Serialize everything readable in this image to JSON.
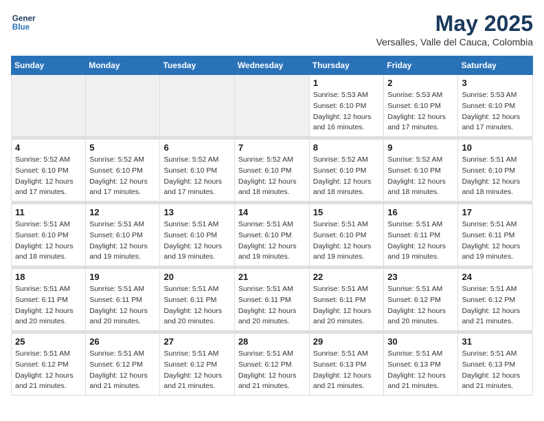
{
  "logo": {
    "line1": "General",
    "line2": "Blue"
  },
  "title": "May 2025",
  "subtitle": "Versalles, Valle del Cauca, Colombia",
  "weekdays": [
    "Sunday",
    "Monday",
    "Tuesday",
    "Wednesday",
    "Thursday",
    "Friday",
    "Saturday"
  ],
  "weeks": [
    [
      {
        "day": "",
        "info": ""
      },
      {
        "day": "",
        "info": ""
      },
      {
        "day": "",
        "info": ""
      },
      {
        "day": "",
        "info": ""
      },
      {
        "day": "1",
        "info": "Sunrise: 5:53 AM\nSunset: 6:10 PM\nDaylight: 12 hours\nand 16 minutes."
      },
      {
        "day": "2",
        "info": "Sunrise: 5:53 AM\nSunset: 6:10 PM\nDaylight: 12 hours\nand 17 minutes."
      },
      {
        "day": "3",
        "info": "Sunrise: 5:53 AM\nSunset: 6:10 PM\nDaylight: 12 hours\nand 17 minutes."
      }
    ],
    [
      {
        "day": "4",
        "info": "Sunrise: 5:52 AM\nSunset: 6:10 PM\nDaylight: 12 hours\nand 17 minutes."
      },
      {
        "day": "5",
        "info": "Sunrise: 5:52 AM\nSunset: 6:10 PM\nDaylight: 12 hours\nand 17 minutes."
      },
      {
        "day": "6",
        "info": "Sunrise: 5:52 AM\nSunset: 6:10 PM\nDaylight: 12 hours\nand 17 minutes."
      },
      {
        "day": "7",
        "info": "Sunrise: 5:52 AM\nSunset: 6:10 PM\nDaylight: 12 hours\nand 18 minutes."
      },
      {
        "day": "8",
        "info": "Sunrise: 5:52 AM\nSunset: 6:10 PM\nDaylight: 12 hours\nand 18 minutes."
      },
      {
        "day": "9",
        "info": "Sunrise: 5:52 AM\nSunset: 6:10 PM\nDaylight: 12 hours\nand 18 minutes."
      },
      {
        "day": "10",
        "info": "Sunrise: 5:51 AM\nSunset: 6:10 PM\nDaylight: 12 hours\nand 18 minutes."
      }
    ],
    [
      {
        "day": "11",
        "info": "Sunrise: 5:51 AM\nSunset: 6:10 PM\nDaylight: 12 hours\nand 18 minutes."
      },
      {
        "day": "12",
        "info": "Sunrise: 5:51 AM\nSunset: 6:10 PM\nDaylight: 12 hours\nand 19 minutes."
      },
      {
        "day": "13",
        "info": "Sunrise: 5:51 AM\nSunset: 6:10 PM\nDaylight: 12 hours\nand 19 minutes."
      },
      {
        "day": "14",
        "info": "Sunrise: 5:51 AM\nSunset: 6:10 PM\nDaylight: 12 hours\nand 19 minutes."
      },
      {
        "day": "15",
        "info": "Sunrise: 5:51 AM\nSunset: 6:10 PM\nDaylight: 12 hours\nand 19 minutes."
      },
      {
        "day": "16",
        "info": "Sunrise: 5:51 AM\nSunset: 6:11 PM\nDaylight: 12 hours\nand 19 minutes."
      },
      {
        "day": "17",
        "info": "Sunrise: 5:51 AM\nSunset: 6:11 PM\nDaylight: 12 hours\nand 19 minutes."
      }
    ],
    [
      {
        "day": "18",
        "info": "Sunrise: 5:51 AM\nSunset: 6:11 PM\nDaylight: 12 hours\nand 20 minutes."
      },
      {
        "day": "19",
        "info": "Sunrise: 5:51 AM\nSunset: 6:11 PM\nDaylight: 12 hours\nand 20 minutes."
      },
      {
        "day": "20",
        "info": "Sunrise: 5:51 AM\nSunset: 6:11 PM\nDaylight: 12 hours\nand 20 minutes."
      },
      {
        "day": "21",
        "info": "Sunrise: 5:51 AM\nSunset: 6:11 PM\nDaylight: 12 hours\nand 20 minutes."
      },
      {
        "day": "22",
        "info": "Sunrise: 5:51 AM\nSunset: 6:11 PM\nDaylight: 12 hours\nand 20 minutes."
      },
      {
        "day": "23",
        "info": "Sunrise: 5:51 AM\nSunset: 6:12 PM\nDaylight: 12 hours\nand 20 minutes."
      },
      {
        "day": "24",
        "info": "Sunrise: 5:51 AM\nSunset: 6:12 PM\nDaylight: 12 hours\nand 21 minutes."
      }
    ],
    [
      {
        "day": "25",
        "info": "Sunrise: 5:51 AM\nSunset: 6:12 PM\nDaylight: 12 hours\nand 21 minutes."
      },
      {
        "day": "26",
        "info": "Sunrise: 5:51 AM\nSunset: 6:12 PM\nDaylight: 12 hours\nand 21 minutes."
      },
      {
        "day": "27",
        "info": "Sunrise: 5:51 AM\nSunset: 6:12 PM\nDaylight: 12 hours\nand 21 minutes."
      },
      {
        "day": "28",
        "info": "Sunrise: 5:51 AM\nSunset: 6:12 PM\nDaylight: 12 hours\nand 21 minutes."
      },
      {
        "day": "29",
        "info": "Sunrise: 5:51 AM\nSunset: 6:13 PM\nDaylight: 12 hours\nand 21 minutes."
      },
      {
        "day": "30",
        "info": "Sunrise: 5:51 AM\nSunset: 6:13 PM\nDaylight: 12 hours\nand 21 minutes."
      },
      {
        "day": "31",
        "info": "Sunrise: 5:51 AM\nSunset: 6:13 PM\nDaylight: 12 hours\nand 21 minutes."
      }
    ]
  ]
}
